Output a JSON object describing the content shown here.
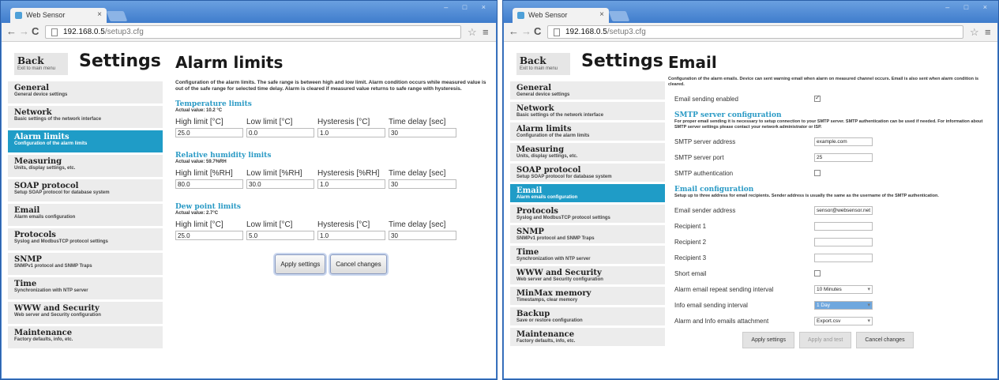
{
  "browser": {
    "tab_title": "Web Sensor",
    "close": "×",
    "window_controls": "– □ ×",
    "back": "←",
    "forward": "→",
    "reload": "C",
    "star": "☆",
    "menu": "≡"
  },
  "left": {
    "url_host": "192.168.0.5",
    "url_path": "/setup3.cfg",
    "back": {
      "label": "Back",
      "sub": "Exit to main menu"
    },
    "settings_title": "Settings",
    "nav": [
      {
        "label": "General",
        "sub": "General device settings"
      },
      {
        "label": "Network",
        "sub": "Basic settings of the network interface"
      },
      {
        "label": "Alarm limits",
        "sub": "Configuration of the alarm limits"
      },
      {
        "label": "Measuring",
        "sub": "Units, display settings, etc."
      },
      {
        "label": "SOAP protocol",
        "sub": "Setup SOAP protocol for database system"
      },
      {
        "label": "Email",
        "sub": "Alarm emails configuration"
      },
      {
        "label": "Protocols",
        "sub": "Syslog and ModbusTCP protocol settings"
      },
      {
        "label": "SNMP",
        "sub": "SNMPv1 protocol and SNMP Traps"
      },
      {
        "label": "Time",
        "sub": "Synchronization with NTP server"
      },
      {
        "label": "WWW and Security",
        "sub": "Web server and Security configuration"
      },
      {
        "label": "Maintenance",
        "sub": "Factory defaults, info, etc."
      }
    ],
    "page_title": "Alarm limits",
    "description": "Configuration of the alarm limits. The safe range is between high and low limit. Alarm condition occurs while measured value is out of the safe range for selected time delay. Alarm is cleared if measured value returns to safe range with hysteresis.",
    "sections": [
      {
        "title": "Temperature limits",
        "actual": "Actual value: 10.2 °C",
        "headers": [
          "High limit [°C]",
          "Low limit [°C]",
          "Hysteresis [°C]",
          "Time delay [sec]"
        ],
        "values": [
          "25.0",
          "0.0",
          "1.0",
          "30"
        ]
      },
      {
        "title": "Relative humidity limits",
        "actual": "Actual value: 59.7%RH",
        "headers": [
          "High limit [%RH]",
          "Low limit [%RH]",
          "Hysteresis [%RH]",
          "Time delay [sec]"
        ],
        "values": [
          "80.0",
          "30.0",
          "1.0",
          "30"
        ]
      },
      {
        "title": "Dew point limits",
        "actual": "Actual value: 2.7°C",
        "headers": [
          "High limit [°C]",
          "Low limit [°C]",
          "Hysteresis [°C]",
          "Time delay [sec]"
        ],
        "values": [
          "25.0",
          "5.0",
          "1.0",
          "30"
        ]
      }
    ],
    "buttons": {
      "apply": "Apply settings",
      "cancel": "Cancel changes"
    }
  },
  "right": {
    "url_host": "192.168.0.5",
    "url_path": "/setup3.cfg",
    "back": {
      "label": "Back",
      "sub": "Exit to main menu"
    },
    "settings_title": "Settings",
    "nav": [
      {
        "label": "General",
        "sub": "General device settings"
      },
      {
        "label": "Network",
        "sub": "Basic settings of the network interface"
      },
      {
        "label": "Alarm limits",
        "sub": "Configuration of the alarm limits"
      },
      {
        "label": "Measuring",
        "sub": "Units, display settings, etc."
      },
      {
        "label": "SOAP protocol",
        "sub": "Setup SOAP protocol for database system"
      },
      {
        "label": "Email",
        "sub": "Alarm emails configuration"
      },
      {
        "label": "Protocols",
        "sub": "Syslog and ModbusTCP protocol settings"
      },
      {
        "label": "SNMP",
        "sub": "SNMPv1 protocol and SNMP Traps"
      },
      {
        "label": "Time",
        "sub": "Synchronization with NTP server"
      },
      {
        "label": "WWW and Security",
        "sub": "Web server and Security configuration"
      },
      {
        "label": "MinMax memory",
        "sub": "Timestamps, clear memory"
      },
      {
        "label": "Backup",
        "sub": "Save or restore configuration"
      },
      {
        "label": "Maintenance",
        "sub": "Factory defaults, info, etc."
      }
    ],
    "page_title": "Email",
    "description": "Configuration of the alarm emails. Device can sent warning email when alarm on measured channel occurs. Email is also sent when alarm condition is cleared.",
    "email_enabled_label": "Email sending enabled",
    "smtp": {
      "title": "SMTP server configuration",
      "desc": "For proper email sending it is necessary to setup connection to your SMTP server. SMTP authentication can be used if needed. For information about SMTP server settings please contact your network administrator or ISP.",
      "address_label": "SMTP server address",
      "address_value": "example.com",
      "port_label": "SMTP server port",
      "port_value": "25",
      "auth_label": "SMTP authentication"
    },
    "email_conf": {
      "title": "Email configuration",
      "desc": "Setup up to three address for email recipients. Sender address is usually the same as the username of the SMTP authentication.",
      "sender_label": "Email sender address",
      "sender_value": "sensor@websensor.net",
      "r1_label": "Recipient 1",
      "r2_label": "Recipient 2",
      "r3_label": "Recipient 3",
      "short_label": "Short email",
      "repeat_label": "Alarm email repeat sending interval",
      "repeat_value": "10 Minutes",
      "info_label": "Info email sending interval",
      "info_value": "1 Day",
      "attach_label": "Alarm and Info emails attachment",
      "attach_value": "Export.csv"
    },
    "buttons": {
      "apply": "Apply settings",
      "test": "Apply and test",
      "cancel": "Cancel changes"
    }
  }
}
